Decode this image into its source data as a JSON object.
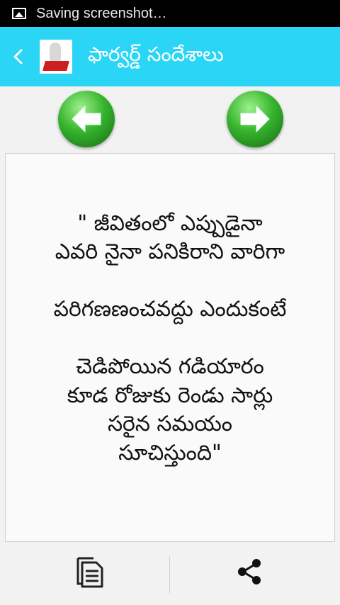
{
  "status_bar": {
    "notification_icon": "image-icon",
    "text": "Saving screenshot…"
  },
  "app_bar": {
    "back_icon": "chevron-left-icon",
    "title": "ఫార్వర్డ్ సందేశాలు",
    "accent_color": "#2ad5f5"
  },
  "navigation": {
    "prev_icon": "arrow-left-icon",
    "next_icon": "arrow-right-icon",
    "button_color": "#37b52d"
  },
  "message": {
    "text": "\" జీవితంలో ఎప్పుడైనా\nఎవరి నైనా పనికిరాని వారిగా\n\nపరిగణణంచవద్దు ఎందుకంటే\n\nచెడిపోయిన గడియారం\nకూడ రోజుకు రెండు సార్లు\nసరైన సమయం\nసూచిస్తుంది\""
  },
  "bottom_bar": {
    "copy_icon": "copy-icon",
    "share_icon": "share-icon"
  }
}
